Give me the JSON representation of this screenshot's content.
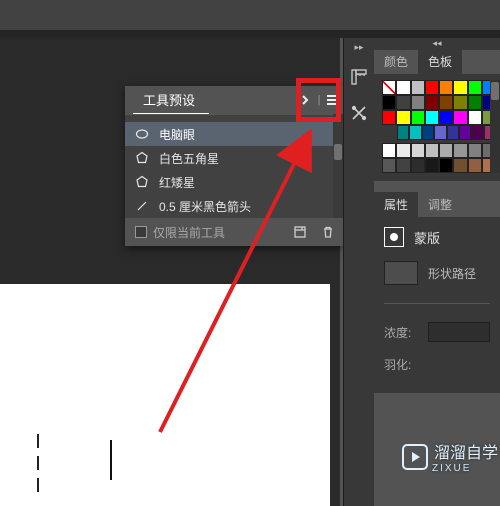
{
  "topbar": {},
  "tool_panel": {
    "title": "工具预设",
    "items": [
      {
        "label": ""
      },
      {
        "label": "电脑眼"
      },
      {
        "label": "白色五角星"
      },
      {
        "label": "红矮星"
      },
      {
        "label": "0.5 厘米黑色箭头"
      }
    ],
    "restrict_label": "仅限当前工具"
  },
  "right": {
    "color_tabs": {
      "color": "颜色",
      "swatches": "色板"
    },
    "prop_tabs": {
      "properties": "属性",
      "adjust": "调整"
    },
    "mask_label": "蒙版",
    "shape_path_label": "形状路径",
    "density_label": "浓度:",
    "feather_label": "羽化:"
  },
  "swatches_colors": [
    [
      "none",
      "#ffffff",
      "#c0c0c0",
      "#ff0000",
      "#ff8000",
      "#ffff00",
      "#00ff00",
      "#0080ff"
    ],
    [
      "#000000",
      "#404040",
      "#808080",
      "#800000",
      "#804000",
      "#808000",
      "#008000",
      "#000080"
    ],
    [
      "#ff0000",
      "#ffff00",
      "#00ff00",
      "#00ffff",
      "#0000ff",
      "#ff00ff",
      "#ffffff",
      "#7a9b3e"
    ],
    [
      "#008080",
      "#00c0c0",
      "#004080",
      "#6666cc",
      "#333399",
      "#660099",
      "#4d004d",
      "#993366"
    ]
  ],
  "gray_swatches": [
    [
      "#ffffff",
      "#eaeaea",
      "#d5d5d5",
      "#c0c0c0",
      "#ababab",
      "#969696",
      "#818181",
      "#6c6c6c"
    ],
    [
      "#575757",
      "#424242",
      "#2d2d2d",
      "#181818",
      "#000000",
      "#705030",
      "#906040",
      "#b07050"
    ]
  ],
  "watermark": {
    "text": "溜溜自学",
    "sub": "ZIXUE"
  }
}
